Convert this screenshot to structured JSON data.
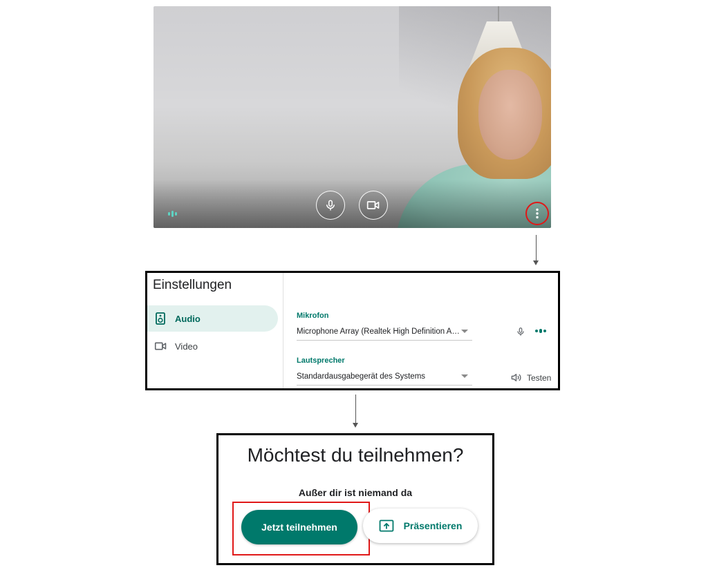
{
  "video_preview": {
    "mic_icon": "microphone-icon",
    "camera_icon": "videocam-icon",
    "more_icon": "more-vert-icon",
    "audio_level_icon": "audio-level-icon"
  },
  "settings": {
    "title": "Einstellungen",
    "nav": [
      {
        "label": "Audio",
        "icon": "speaker-icon",
        "active": true
      },
      {
        "label": "Video",
        "icon": "videocam-icon",
        "active": false
      }
    ],
    "microphone": {
      "label": "Mikrofon",
      "value": "Microphone Array (Realtek High Definition Audio)"
    },
    "speaker": {
      "label": "Lautsprecher",
      "value": "Standardausgabegerät des Systems",
      "test_label": "Testen"
    }
  },
  "join": {
    "title": "Möchtest du teilnehmen?",
    "subtitle": "Außer dir ist niemand da",
    "join_button": "Jetzt teilnehmen",
    "present_button": "Präsentieren"
  },
  "colors": {
    "accent": "#00796b",
    "highlight": "#e01818",
    "nav_active_bg": "#e2f1ee"
  }
}
